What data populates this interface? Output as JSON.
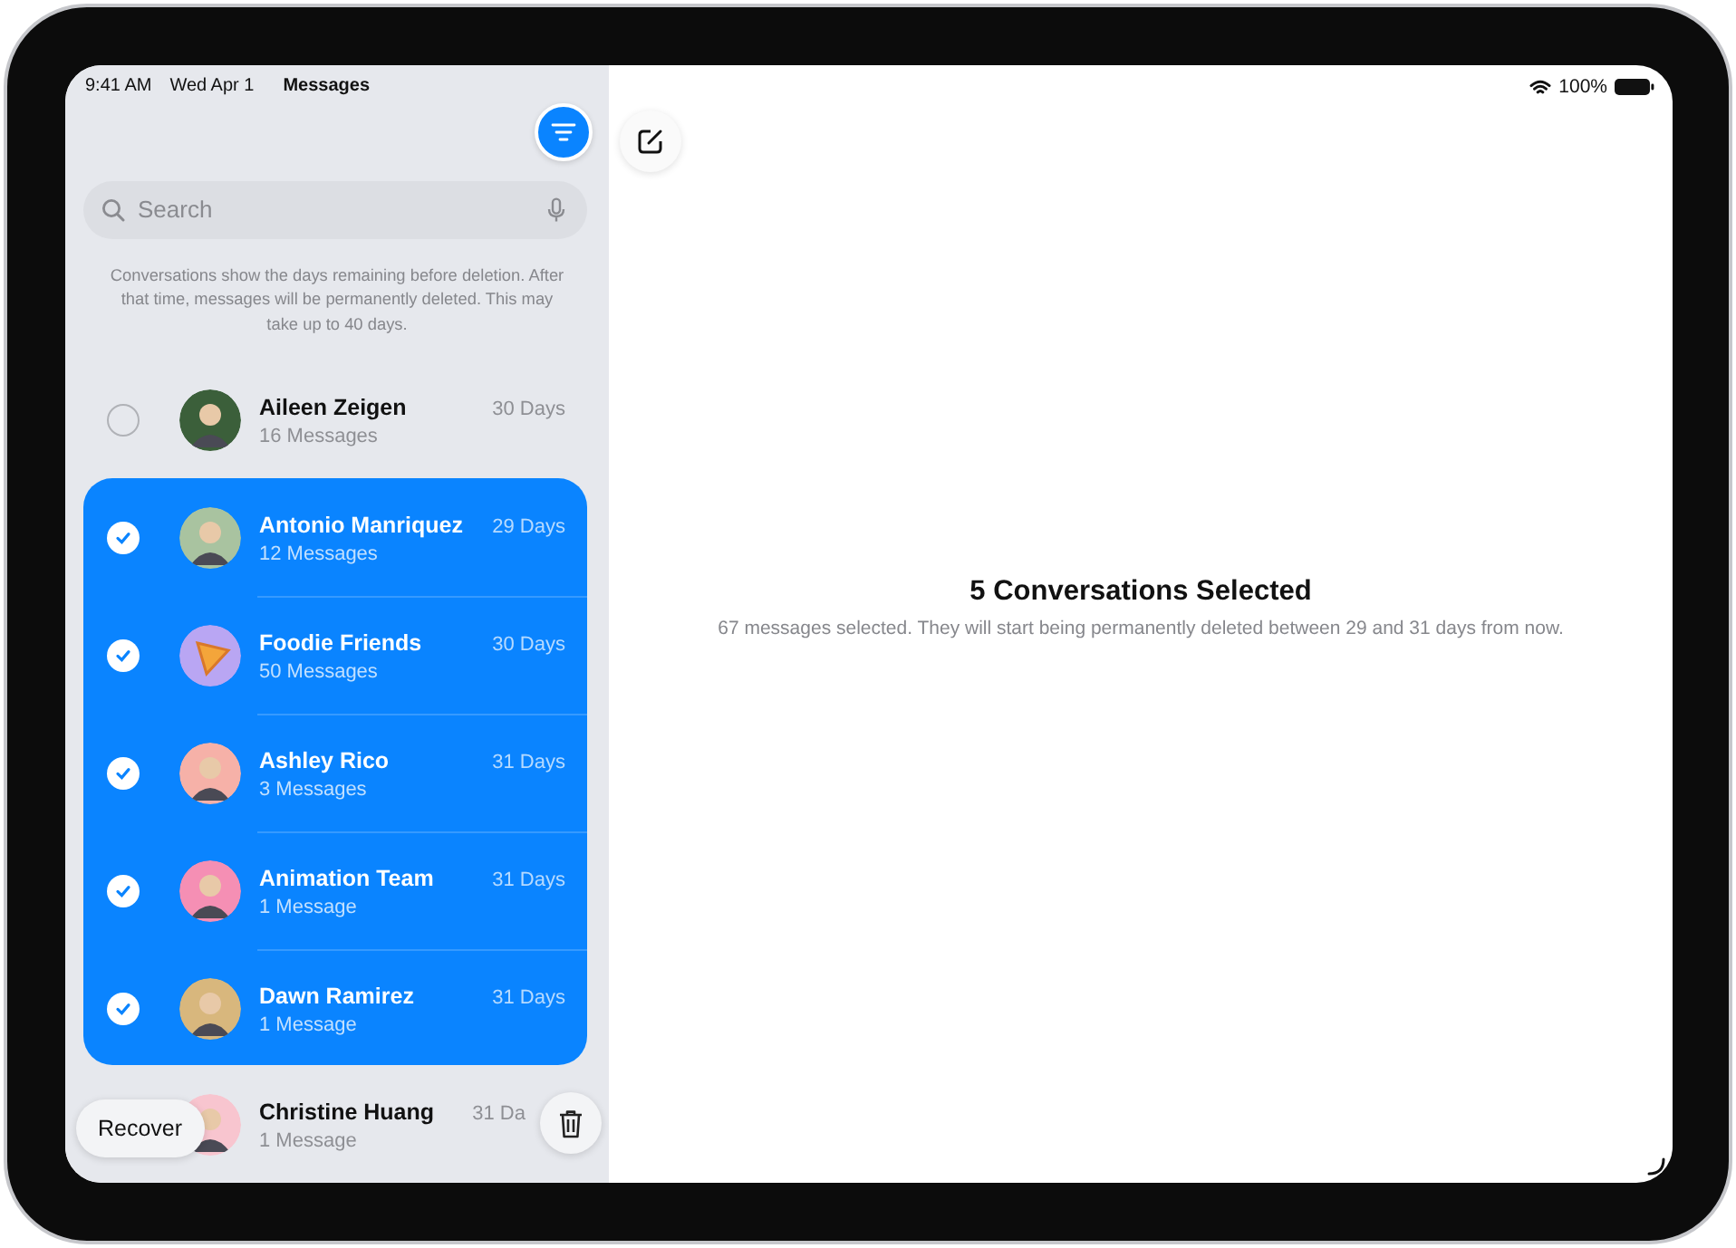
{
  "status_bar": {
    "time": "9:41 AM",
    "date": "Wed Apr 1",
    "app": "Messages",
    "battery": "100%"
  },
  "search": {
    "placeholder": "Search"
  },
  "note": "Conversations show the days remaining before deletion. After that time, messages will be permanently deleted. This may take up to 40 days.",
  "conversations": [
    {
      "name": "Aileen Zeigen",
      "count": "16 Messages",
      "days": "30 Days",
      "selected": false
    },
    {
      "name": "Antonio Manriquez",
      "count": "12 Messages",
      "days": "29 Days",
      "selected": true
    },
    {
      "name": "Foodie Friends",
      "count": "50 Messages",
      "days": "30 Days",
      "selected": true
    },
    {
      "name": "Ashley Rico",
      "count": "3 Messages",
      "days": "31 Days",
      "selected": true
    },
    {
      "name": "Animation Team",
      "count": "1 Message",
      "days": "31 Days",
      "selected": true
    },
    {
      "name": "Dawn Ramirez",
      "count": "1 Message",
      "days": "31 Days",
      "selected": true
    }
  ],
  "partial_row": {
    "name": "Christine Huang",
    "count": "1 Message",
    "days": "31 Da"
  },
  "recover_button": "Recover",
  "detail": {
    "title": "5 Conversations Selected",
    "subtitle": "67 messages selected. They will start being permanently deleted between 29 and 31 days from now."
  }
}
